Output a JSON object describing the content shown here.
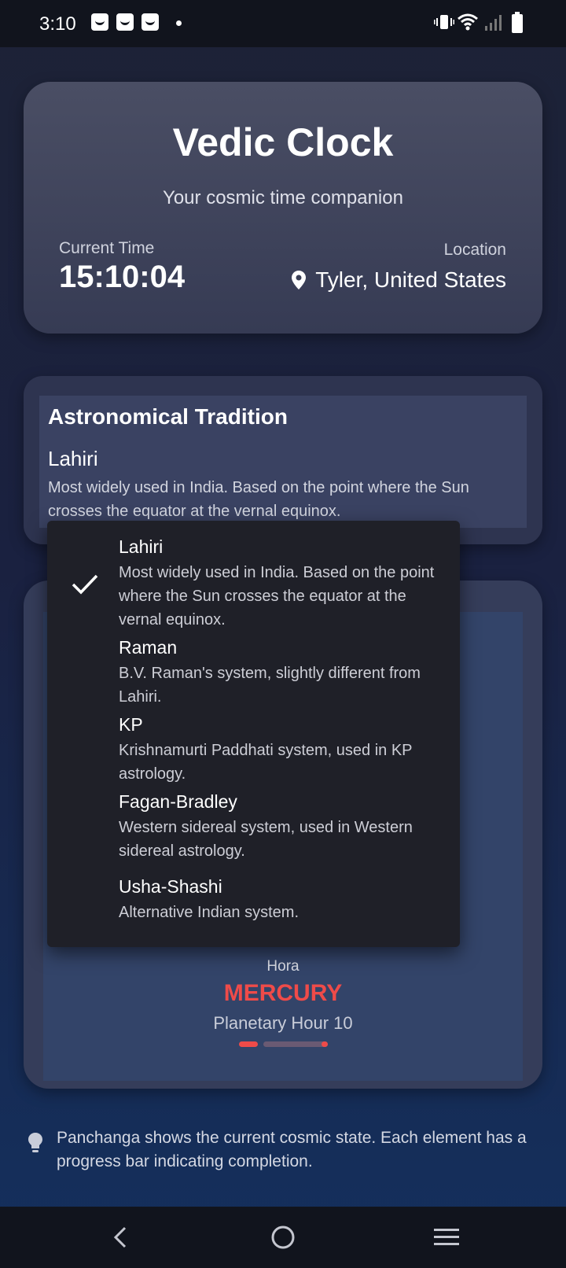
{
  "status_bar": {
    "time": "3:10",
    "icons": [
      "shopping-bag-icon",
      "shopping-bag-icon",
      "shopping-bag-icon",
      "notification-dot-icon",
      "vibrate-icon",
      "wifi-icon",
      "signal-icon",
      "battery-icon"
    ]
  },
  "header": {
    "title": "Vedic Clock",
    "subtitle": "Your cosmic time companion",
    "current_time_label": "Current Time",
    "current_time": "15:10:04",
    "location_label": "Location",
    "location": "Tyler, United States"
  },
  "tradition": {
    "title": "Astronomical Tradition",
    "selected": "Lahiri",
    "selected_description": "Most widely used in India. Based on the point where the Sun crosses the equator at the vernal equinox."
  },
  "dropdown": {
    "options": [
      {
        "name": "Lahiri",
        "description": "Most widely used in India. Based on the point where the Sun crosses the equator at the vernal equinox.",
        "selected": true
      },
      {
        "name": "Raman",
        "description": "B.V. Raman's system, slightly different from Lahiri.",
        "selected": false
      },
      {
        "name": "KP",
        "description": "Krishnamurti Paddhati system, used in KP astrology.",
        "selected": false
      },
      {
        "name": "Fagan-Bradley",
        "description": "Western sidereal system, used in Western sidereal astrology.",
        "selected": false
      },
      {
        "name": "Usha-Shashi",
        "description": "Alternative Indian system.",
        "selected": false
      }
    ]
  },
  "panchanga": {
    "hora_label": "Hora",
    "hora_value": "MERCURY",
    "planetary_hour": "Planetary Hour 10"
  },
  "tip": {
    "text": "Panchanga shows the current cosmic state. Each element has a progress bar indicating completion."
  },
  "colors": {
    "accent_red": "#ef4b49",
    "background_top": "#1d2236",
    "background_bottom": "#14305e"
  }
}
